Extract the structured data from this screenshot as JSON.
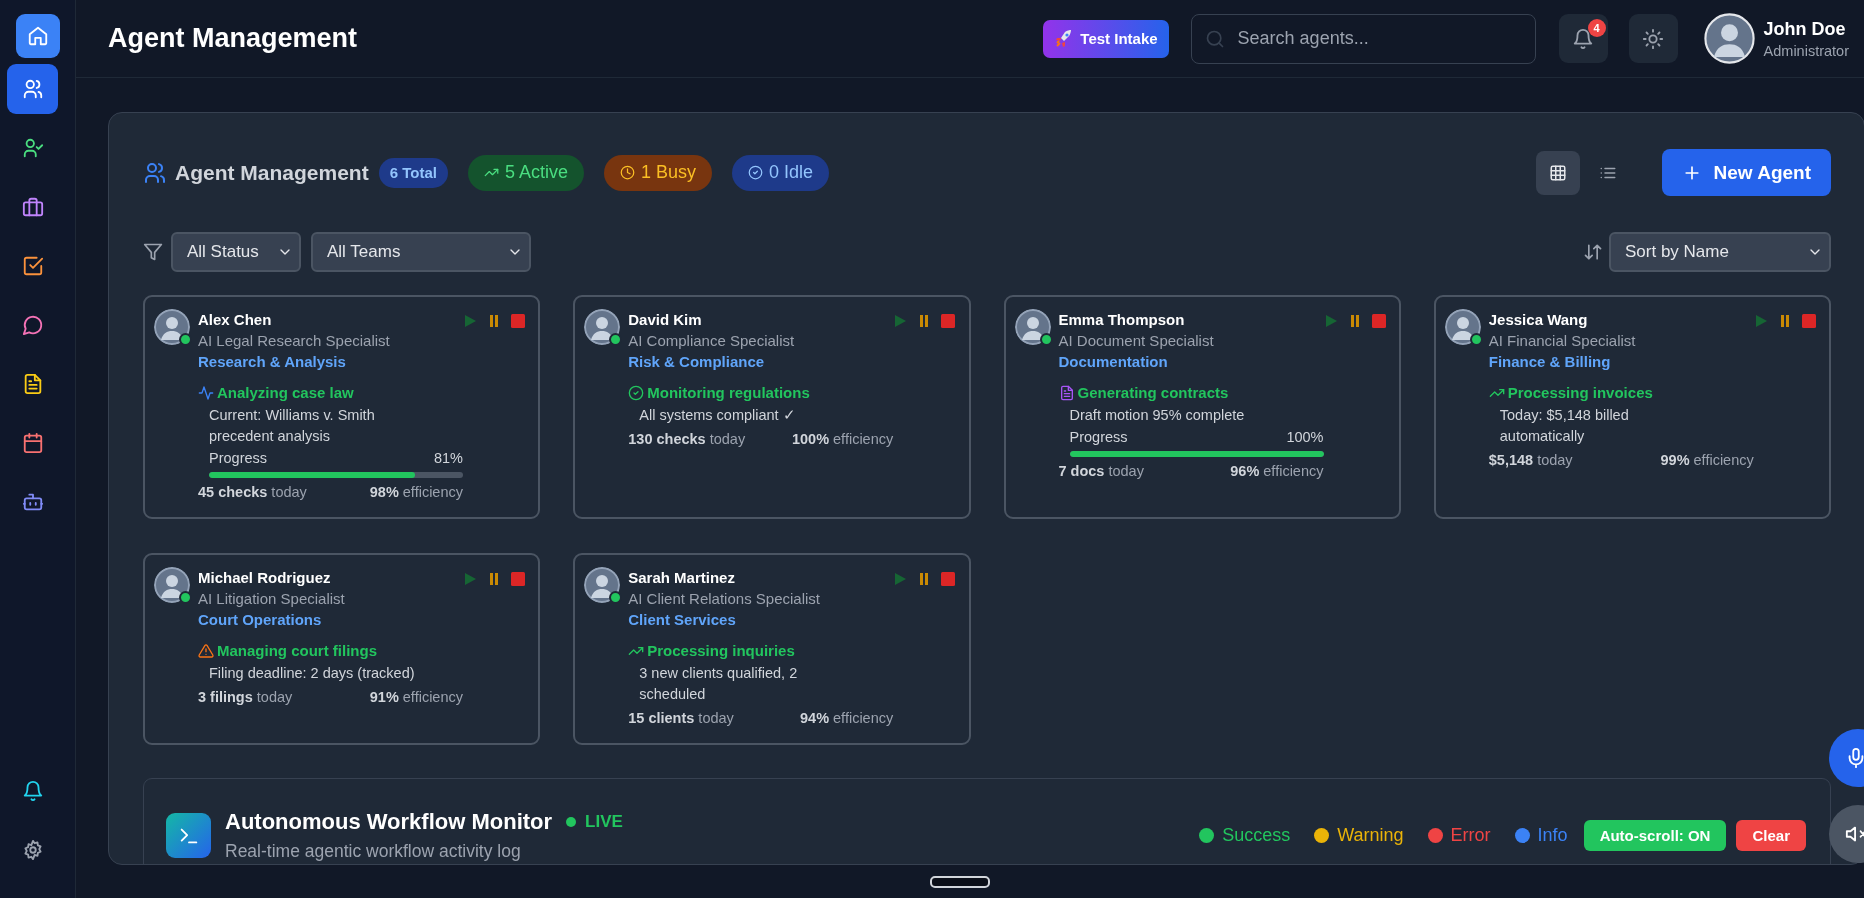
{
  "sidebar": {
    "items": [
      {
        "selected": true
      },
      {
        "selected": false
      },
      {
        "selected": false
      },
      {
        "selected": false
      },
      {
        "selected": false
      },
      {
        "selected": false
      },
      {
        "selected": false
      },
      {
        "selected": false
      }
    ],
    "bottom_items": [
      {
        "selected": false
      },
      {
        "selected": false
      }
    ]
  },
  "header": {
    "title": "Agent Management",
    "test_button": "Test Intake",
    "search": {
      "placeholder": "Search agents..."
    },
    "notifications": {
      "count": "4"
    },
    "user": {
      "name": "John Doe",
      "role": "Administrator"
    }
  },
  "panel": {
    "title": "Agent Management",
    "total": "6 Total",
    "stats": [
      {
        "kind": "active",
        "label": "5 Active"
      },
      {
        "kind": "busy",
        "label": "1 Busy"
      },
      {
        "kind": "idle",
        "label": "0 Idle"
      }
    ],
    "view_modes": [
      {
        "selected": true
      },
      {
        "selected": false
      }
    ],
    "new_button": "New Agent",
    "filters": [
      {
        "value": "All Status"
      },
      {
        "value": "All Teams"
      }
    ],
    "sort": {
      "value": "Sort by Name"
    }
  },
  "agents": [
    {
      "name": "Alex Chen",
      "role": "AI Legal Research Specialist",
      "team": "Research & Analysis",
      "online": true,
      "activity": "Analyzing case law",
      "detail": "Current: Williams v. Smith precedent analysis",
      "progress": {
        "label": "Progress",
        "value": "81%",
        "level": 0.81
      },
      "stats": [
        "**45 checks** today",
        "**98%** efficiency"
      ]
    },
    {
      "name": "David Kim",
      "role": "AI Compliance Specialist",
      "team": "Risk & Compliance",
      "online": true,
      "activity": "Monitoring regulations",
      "detail": "All systems compliant ✓",
      "stats": [
        "**130 checks** today",
        "**100%** efficiency"
      ]
    },
    {
      "name": "Emma Thompson",
      "role": "AI Document Specialist",
      "team": "Documentation",
      "online": true,
      "activity": "Generating contracts",
      "detail": "Draft motion 95% complete",
      "progress": {
        "label": "Progress",
        "value": "100%",
        "level": 1
      },
      "stats": [
        "**7 docs** today",
        "**96%** efficiency"
      ]
    },
    {
      "name": "Jessica Wang",
      "role": "AI Financial Specialist",
      "team": "Finance & Billing",
      "online": true,
      "activity": "Processing invoices",
      "detail": "Today: $5,148 billed automatically",
      "stats": [
        "**$5,148** today",
        "**99%** efficiency"
      ]
    },
    {
      "name": "Michael Rodriguez",
      "role": "AI Litigation Specialist",
      "team": "Court Operations",
      "online": true,
      "activity": "Managing court filings",
      "detail": "Filing deadline: 2 days (tracked)",
      "stats": [
        "**3 filings** today",
        "**91%** efficiency"
      ]
    },
    {
      "name": "Sarah Martinez",
      "role": "AI Client Relations Specialist",
      "team": "Client Services",
      "online": true,
      "activity": "Processing inquiries",
      "detail": "3 new clients qualified, 2 scheduled",
      "stats": [
        "**15 clients** today",
        "**94%** efficiency"
      ]
    }
  ],
  "monitor": {
    "title": "Autonomous Workflow Monitor",
    "live": "LIVE",
    "subtitle": "Real-time agentic workflow activity log",
    "legend": [
      {
        "label": "Success",
        "color": "#22c55e"
      },
      {
        "label": "Warning",
        "color": "#eab308"
      },
      {
        "label": "Error",
        "color": "#ef4444"
      },
      {
        "label": "Info",
        "color": "#3b82f6"
      }
    ],
    "auto_scroll": "Auto-scroll: ON",
    "clear": "Clear"
  }
}
